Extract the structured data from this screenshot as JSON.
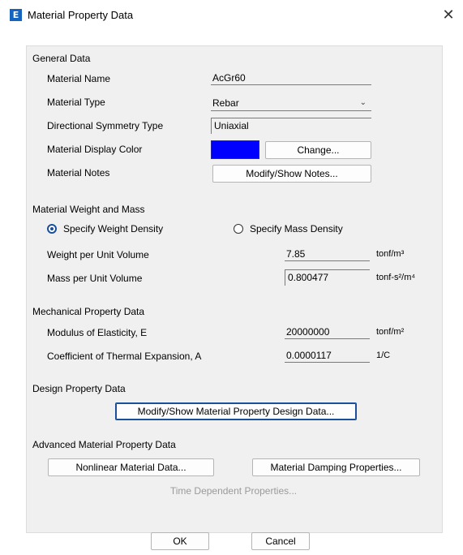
{
  "window": {
    "icon_letter": "E",
    "title": "Material Property Data",
    "close_glyph": "✕"
  },
  "general": {
    "heading": "General Data",
    "material_name_label": "Material Name",
    "material_name_value": "AcGr60",
    "material_type_label": "Material Type",
    "material_type_value": "Rebar",
    "directional_label": "Directional Symmetry Type",
    "directional_value": "Uniaxial",
    "display_color_label": "Material Display Color",
    "display_color": "#0000ff",
    "change_button": "Change...",
    "notes_label": "Material Notes",
    "notes_button": "Modify/Show Notes..."
  },
  "weight_mass": {
    "heading": "Material Weight and Mass",
    "radio_weight": "Specify Weight Density",
    "radio_weight_selected": true,
    "radio_mass": "Specify Mass Density",
    "weight_label": "Weight per Unit Volume",
    "weight_value": "7.85",
    "weight_unit": "tonf/m³",
    "mass_label": "Mass per Unit Volume",
    "mass_value": "0.800477",
    "mass_unit": "tonf-s²/m⁴"
  },
  "mechanical": {
    "heading": "Mechanical Property Data",
    "modulus_label": "Modulus of Elasticity,  E",
    "modulus_value": "20000000",
    "modulus_unit": "tonf/m²",
    "thermal_label": "Coefficient of Thermal Expansion,  A",
    "thermal_value": "0.0000117",
    "thermal_unit": "1/C"
  },
  "design": {
    "heading": "Design Property Data",
    "button": "Modify/Show Material Property Design Data..."
  },
  "advanced": {
    "heading": "Advanced Material Property Data",
    "nonlinear_button": "Nonlinear Material Data...",
    "damping_button": "Material Damping Properties...",
    "time_dependent_button": "Time Dependent Properties..."
  },
  "footer": {
    "ok_button": "OK",
    "cancel_button": "Cancel"
  },
  "icons": {
    "chevron": "chevron-down-icon",
    "close": "close-icon"
  },
  "colors": {
    "accent": "#1a4f9c",
    "app_icon": "#1565c0",
    "panel_bg": "#f0f0f0"
  }
}
